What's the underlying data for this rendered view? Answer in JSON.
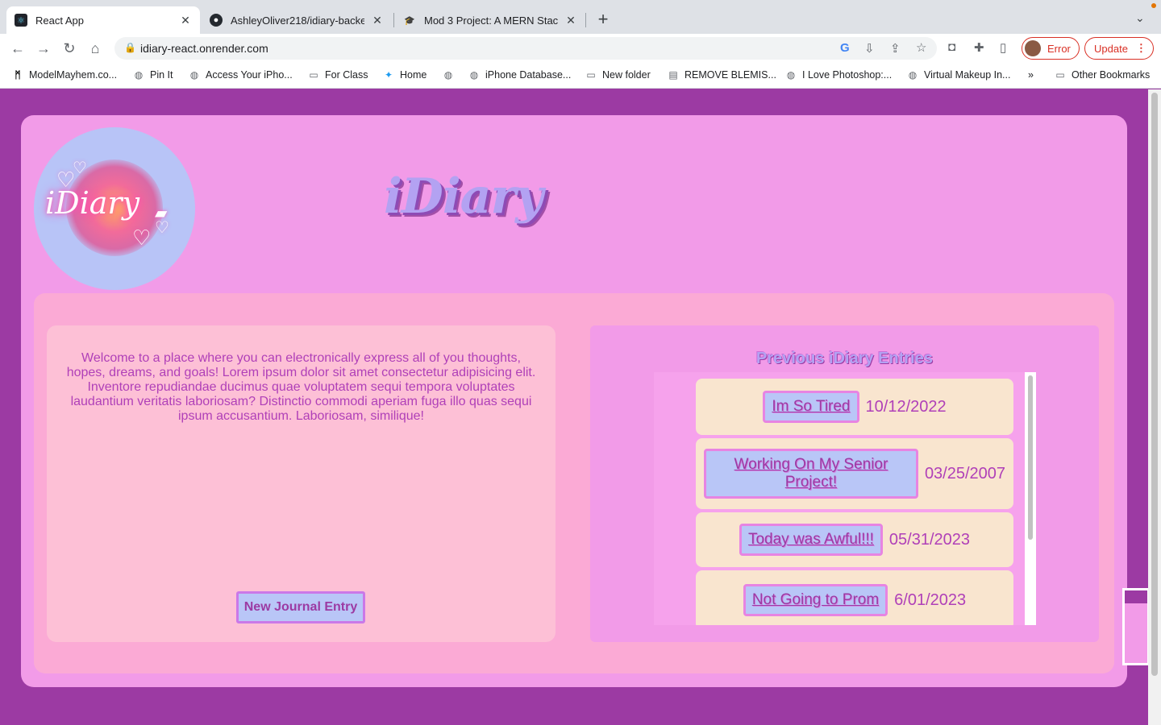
{
  "browser": {
    "tabs": [
      {
        "title": "React App",
        "favicon": "react-icon"
      },
      {
        "title": "AshleyOliver218/idiary-backend",
        "favicon": "github-icon"
      },
      {
        "title": "Mod 3 Project: A MERN Stack /",
        "favicon": "graduation-cap-icon"
      }
    ],
    "url": "idiary-react.onrender.com",
    "profile_status": "Error",
    "update_label": "Update",
    "bookmarks": [
      {
        "label": "ModelMayhem.co...",
        "icon": "mm-icon"
      },
      {
        "label": "Pin It",
        "icon": "globe-icon"
      },
      {
        "label": "Access Your iPho...",
        "icon": "globe-icon"
      },
      {
        "label": "For Class",
        "icon": "folder-icon"
      },
      {
        "label": "Home",
        "icon": "twitter-icon"
      },
      {
        "label": "",
        "icon": "globe-icon"
      },
      {
        "label": "iPhone Database...",
        "icon": "globe-icon"
      },
      {
        "label": "New folder",
        "icon": "folder-icon"
      },
      {
        "label": "REMOVE BLEMIS...",
        "icon": "page-icon"
      },
      {
        "label": "I Love Photoshop:...",
        "icon": "globe-icon"
      },
      {
        "label": "Virtual Makeup In...",
        "icon": "globe-icon"
      }
    ],
    "overflow_label": "»",
    "other_bookmarks": "Other Bookmarks"
  },
  "app": {
    "logo_text": "iDiary",
    "title": "iDiary",
    "welcome_text": "Welcome to a place where you can electronically express all of you thoughts, hopes, dreams, and goals! Lorem ipsum dolor sit amet consectetur adipisicing elit. Inventore repudiandae ducimus quae voluptatem sequi tempora voluptates laudantium veritatis laboriosam? Distinctio commodi aperiam fuga illo quas sequi ipsum accusantium. Laboriosam, similique!",
    "new_entry_label": "New Journal Entry",
    "entries_heading": "Previous iDiary Entries",
    "entries": [
      {
        "title": "Im So Tired",
        "date": "10/12/2022"
      },
      {
        "title": "Working On My Senior Project!",
        "date": "03/25/2007"
      },
      {
        "title": "Today was Awful!!!",
        "date": "05/31/2023"
      },
      {
        "title": "Not Going to Prom",
        "date": "6/01/2023"
      }
    ]
  },
  "colors": {
    "page_bg": "#9c3aa3",
    "frame_bg": "#f29be8",
    "inner_bg": "#fbaad5",
    "left_card_bg": "#fdc0d6",
    "entry_bg": "#f9e5cf",
    "button_bg": "#b9c6f7",
    "title_lavender": "#b3a2f2"
  }
}
